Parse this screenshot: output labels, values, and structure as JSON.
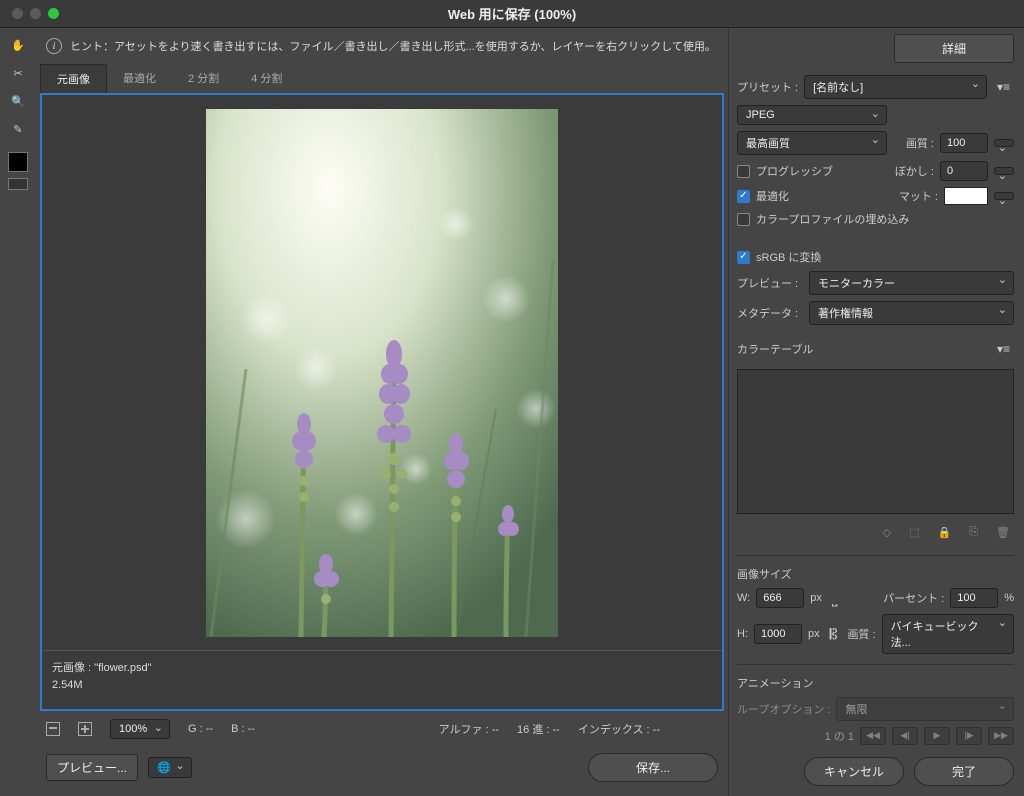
{
  "window": {
    "title": "Web 用に保存 (100%)"
  },
  "hint": {
    "text": "ヒント：アセットをより速く書き出すには、ファイル／書き出し／書き出し形式...を使用するか、レイヤーを右クリックして使用。"
  },
  "tabs": [
    "元画像",
    "最適化",
    "2 分割",
    "4 分割"
  ],
  "tabs_active": 0,
  "canvas_info": {
    "line1": "元画像 : \"flower.psd\"",
    "line2": "2.54M"
  },
  "status_bar": {
    "zoom": "100%",
    "G": "G : --",
    "B": "B : --",
    "alpha": "アルファ : --",
    "hex": "16 進 : --",
    "index": "インデックス : --"
  },
  "buttons": {
    "preview": "プレビュー...",
    "save": "保存...",
    "cancel": "キャンセル",
    "done": "完了",
    "detail": "詳細"
  },
  "right": {
    "preset_label": "プリセット :",
    "preset_value": "[名前なし]",
    "format": "JPEG",
    "quality_preset": "最高画質",
    "quality_label": "画質 :",
    "quality_value": "100",
    "progressive_label": "プログレッシブ",
    "blur_label": "ぼかし :",
    "blur_value": "0",
    "optimize_label": "最適化",
    "matte_label": "マット :",
    "embed_profile_label": "カラープロファイルの埋め込み",
    "srgb_label": "sRGB に変換",
    "preview_label": "プレビュー :",
    "preview_value": "モニターカラー",
    "metadata_label": "メタデータ :",
    "metadata_value": "著作権情報",
    "color_table_label": "カラーテーブル",
    "image_size_label": "画像サイズ",
    "W_label": "W:",
    "W_value": "666",
    "px": "px",
    "H_label": "H:",
    "H_value": "1000",
    "percent_label": "パーセント :",
    "percent_value": "100",
    "percent_unit": "%",
    "quality2_label": "画質 :",
    "quality2_value": "バイキュービック法...",
    "animation_label": "アニメーション",
    "loop_label": "ループオプション :",
    "loop_value": "無限",
    "frame_text": "1 の 1"
  }
}
